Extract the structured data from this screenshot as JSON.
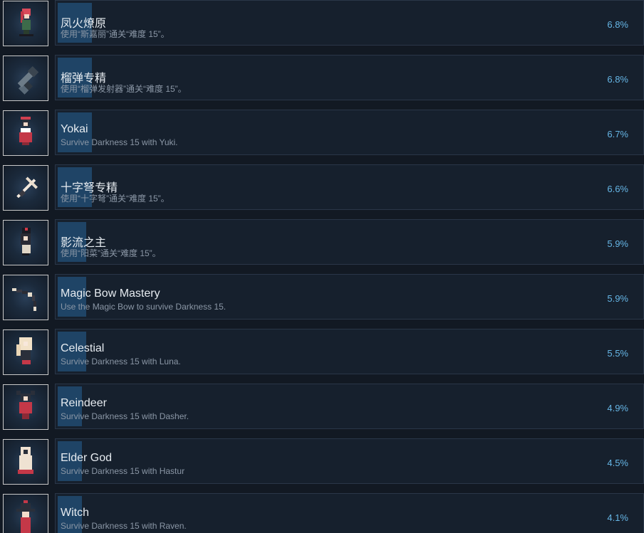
{
  "achievements": [
    {
      "title": "凤火燎原",
      "description": "使用“斯嘉丽”通关“难度 15”。",
      "percent": "6.8%",
      "progress": 0.058,
      "icon": "red-haired-girl-icon"
    },
    {
      "title": "榴弹专精",
      "description": "使用“榴弹发射器”通关“难度 15”。",
      "percent": "6.8%",
      "progress": 0.058,
      "icon": "grenade-launcher-icon"
    },
    {
      "title": "Yokai",
      "description": "Survive Darkness 15 with Yuki.",
      "percent": "6.7%",
      "progress": 0.058,
      "icon": "yokai-girl-icon"
    },
    {
      "title": "十字弩专精",
      "description": "使用“十字弩”通关“难度 15”。",
      "percent": "6.6%",
      "progress": 0.058,
      "icon": "crossbow-icon"
    },
    {
      "title": "影流之主",
      "description": "使用“阳菜”通关“难度 15”。",
      "percent": "5.9%",
      "progress": 0.049,
      "icon": "shadow-girl-icon"
    },
    {
      "title": "Magic Bow Mastery",
      "description": "Use the Magic Bow to survive Darkness 15.",
      "percent": "5.9%",
      "progress": 0.049,
      "icon": "magic-bow-icon"
    },
    {
      "title": "Celestial",
      "description": "Survive Darkness 15 with Luna.",
      "percent": "5.5%",
      "progress": 0.049,
      "icon": "celestial-girl-icon"
    },
    {
      "title": "Reindeer",
      "description": "Survive Darkness 15 with Dasher.",
      "percent": "4.9%",
      "progress": 0.041,
      "icon": "reindeer-girl-icon"
    },
    {
      "title": "Elder God",
      "description": "Survive Darkness 15 with Hastur",
      "percent": "4.5%",
      "progress": 0.041,
      "icon": "elder-god-icon"
    },
    {
      "title": "Witch",
      "description": "Survive Darkness 15 with Raven.",
      "percent": "4.1%",
      "progress": 0.041,
      "icon": "witch-icon"
    }
  ],
  "colors": {
    "background": "#121923",
    "progress_fill": "#1f4466",
    "percent_text": "#66b6e6"
  }
}
